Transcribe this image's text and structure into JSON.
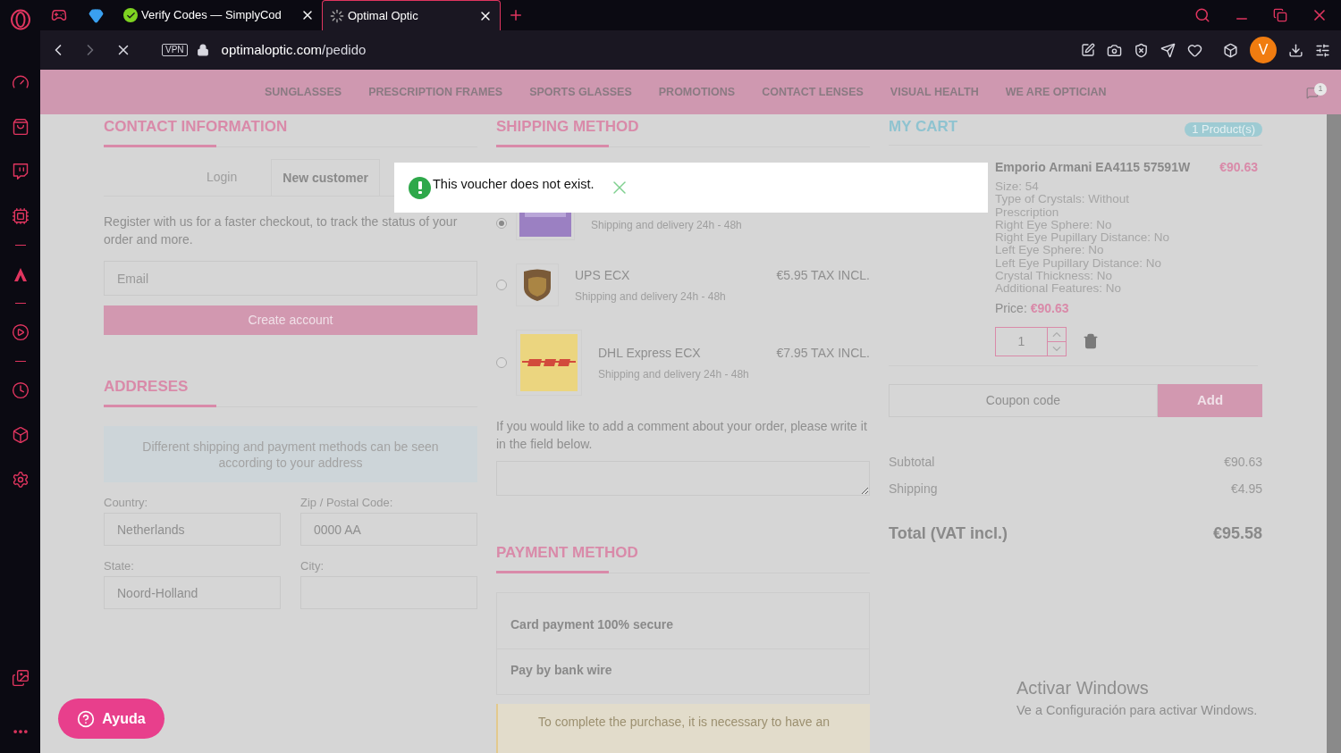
{
  "browser": {
    "tabs": [
      {
        "title": "Verify Codes — SimplyCod",
        "selected": false
      },
      {
        "title": "Optimal Optic",
        "selected": true
      }
    ],
    "address": {
      "vpn": "VPN",
      "domain": "optimaloptic.com",
      "path": "/pedido"
    },
    "avatar": "V"
  },
  "nav": {
    "items": [
      "SUNGLASSES",
      "PRESCRIPTION FRAMES",
      "SPORTS GLASSES",
      "PROMOTIONS",
      "CONTACT LENSES",
      "VISUAL HEALTH",
      "WE ARE OPTICIAN"
    ],
    "cart_count": "1"
  },
  "contact": {
    "heading": "CONTACT INFORMATION",
    "tabs": [
      {
        "label": "Login",
        "selected": false
      },
      {
        "label": "New customer",
        "selected": true
      }
    ],
    "intro": "Register with us for a faster checkout, to track the status of your order and more.",
    "email_placeholder": "Email",
    "create_button": "Create account"
  },
  "addresses": {
    "heading": "ADDRESES",
    "notice": "Different shipping and payment methods can be seen according to your address",
    "fields": [
      {
        "label": "Country:",
        "value": "Netherlands"
      },
      {
        "label": "Zip / Postal Code:",
        "placeholder": "0000 AA"
      },
      {
        "label": "State:",
        "value": "Noord-Holland"
      },
      {
        "label": "City:"
      }
    ]
  },
  "shipping": {
    "heading": "SHIPPING METHOD",
    "options": [
      {
        "kind": "fedex",
        "selected": true,
        "delivery": "Shipping and delivery 24h - 48h"
      },
      {
        "kind": "ups",
        "selected": false,
        "name": "UPS ECX",
        "price": "€5.95 TAX INCL.",
        "delivery": "Shipping and delivery 24h - 48h"
      },
      {
        "kind": "dhl",
        "selected": false,
        "name": "DHL Express ECX",
        "price": "€7.95 TAX INCL.",
        "delivery": "Shipping and delivery 24h - 48h"
      }
    ],
    "comment_prompt": "If you would like to add a comment about your order, please write it in the field below."
  },
  "payment": {
    "heading": "PAYMENT METHOD",
    "options": [
      "Card payment 100% secure",
      "Pay by bank wire"
    ],
    "notice": "To complete the purchase, it is necessary to have an"
  },
  "cart": {
    "heading": "MY CART",
    "count_badge": "1 Product(s)",
    "product": {
      "name": "Emporio Armani EA4115 57591W",
      "price": "€90.63",
      "details": [
        "Size: 54",
        "Type of Crystals: Without Prescription",
        "Right Eye Sphere: No",
        "Right Eye Pupillary Distance: No",
        "Left Eye Sphere: No",
        "Left Eye Pupillary Distance: No",
        "Crystal Thickness: No",
        "Additional Features: No"
      ],
      "price_label": "Price:",
      "price_value": "€90.63",
      "quantity": "1"
    },
    "coupon_placeholder": "Coupon code",
    "add_button": "Add",
    "subtotal": {
      "label": "Subtotal",
      "value": "€90.63"
    },
    "shipping": {
      "label": "Shipping",
      "value": "€4.95"
    },
    "total": {
      "label": "Total (VAT incl.)",
      "value": "€95.58"
    }
  },
  "toast": {
    "message": "This voucher does not exist."
  },
  "help_button": "Ayuda",
  "os_notice": {
    "title": "Activar Windows",
    "text": "Ve a Configuración para activar Windows."
  }
}
